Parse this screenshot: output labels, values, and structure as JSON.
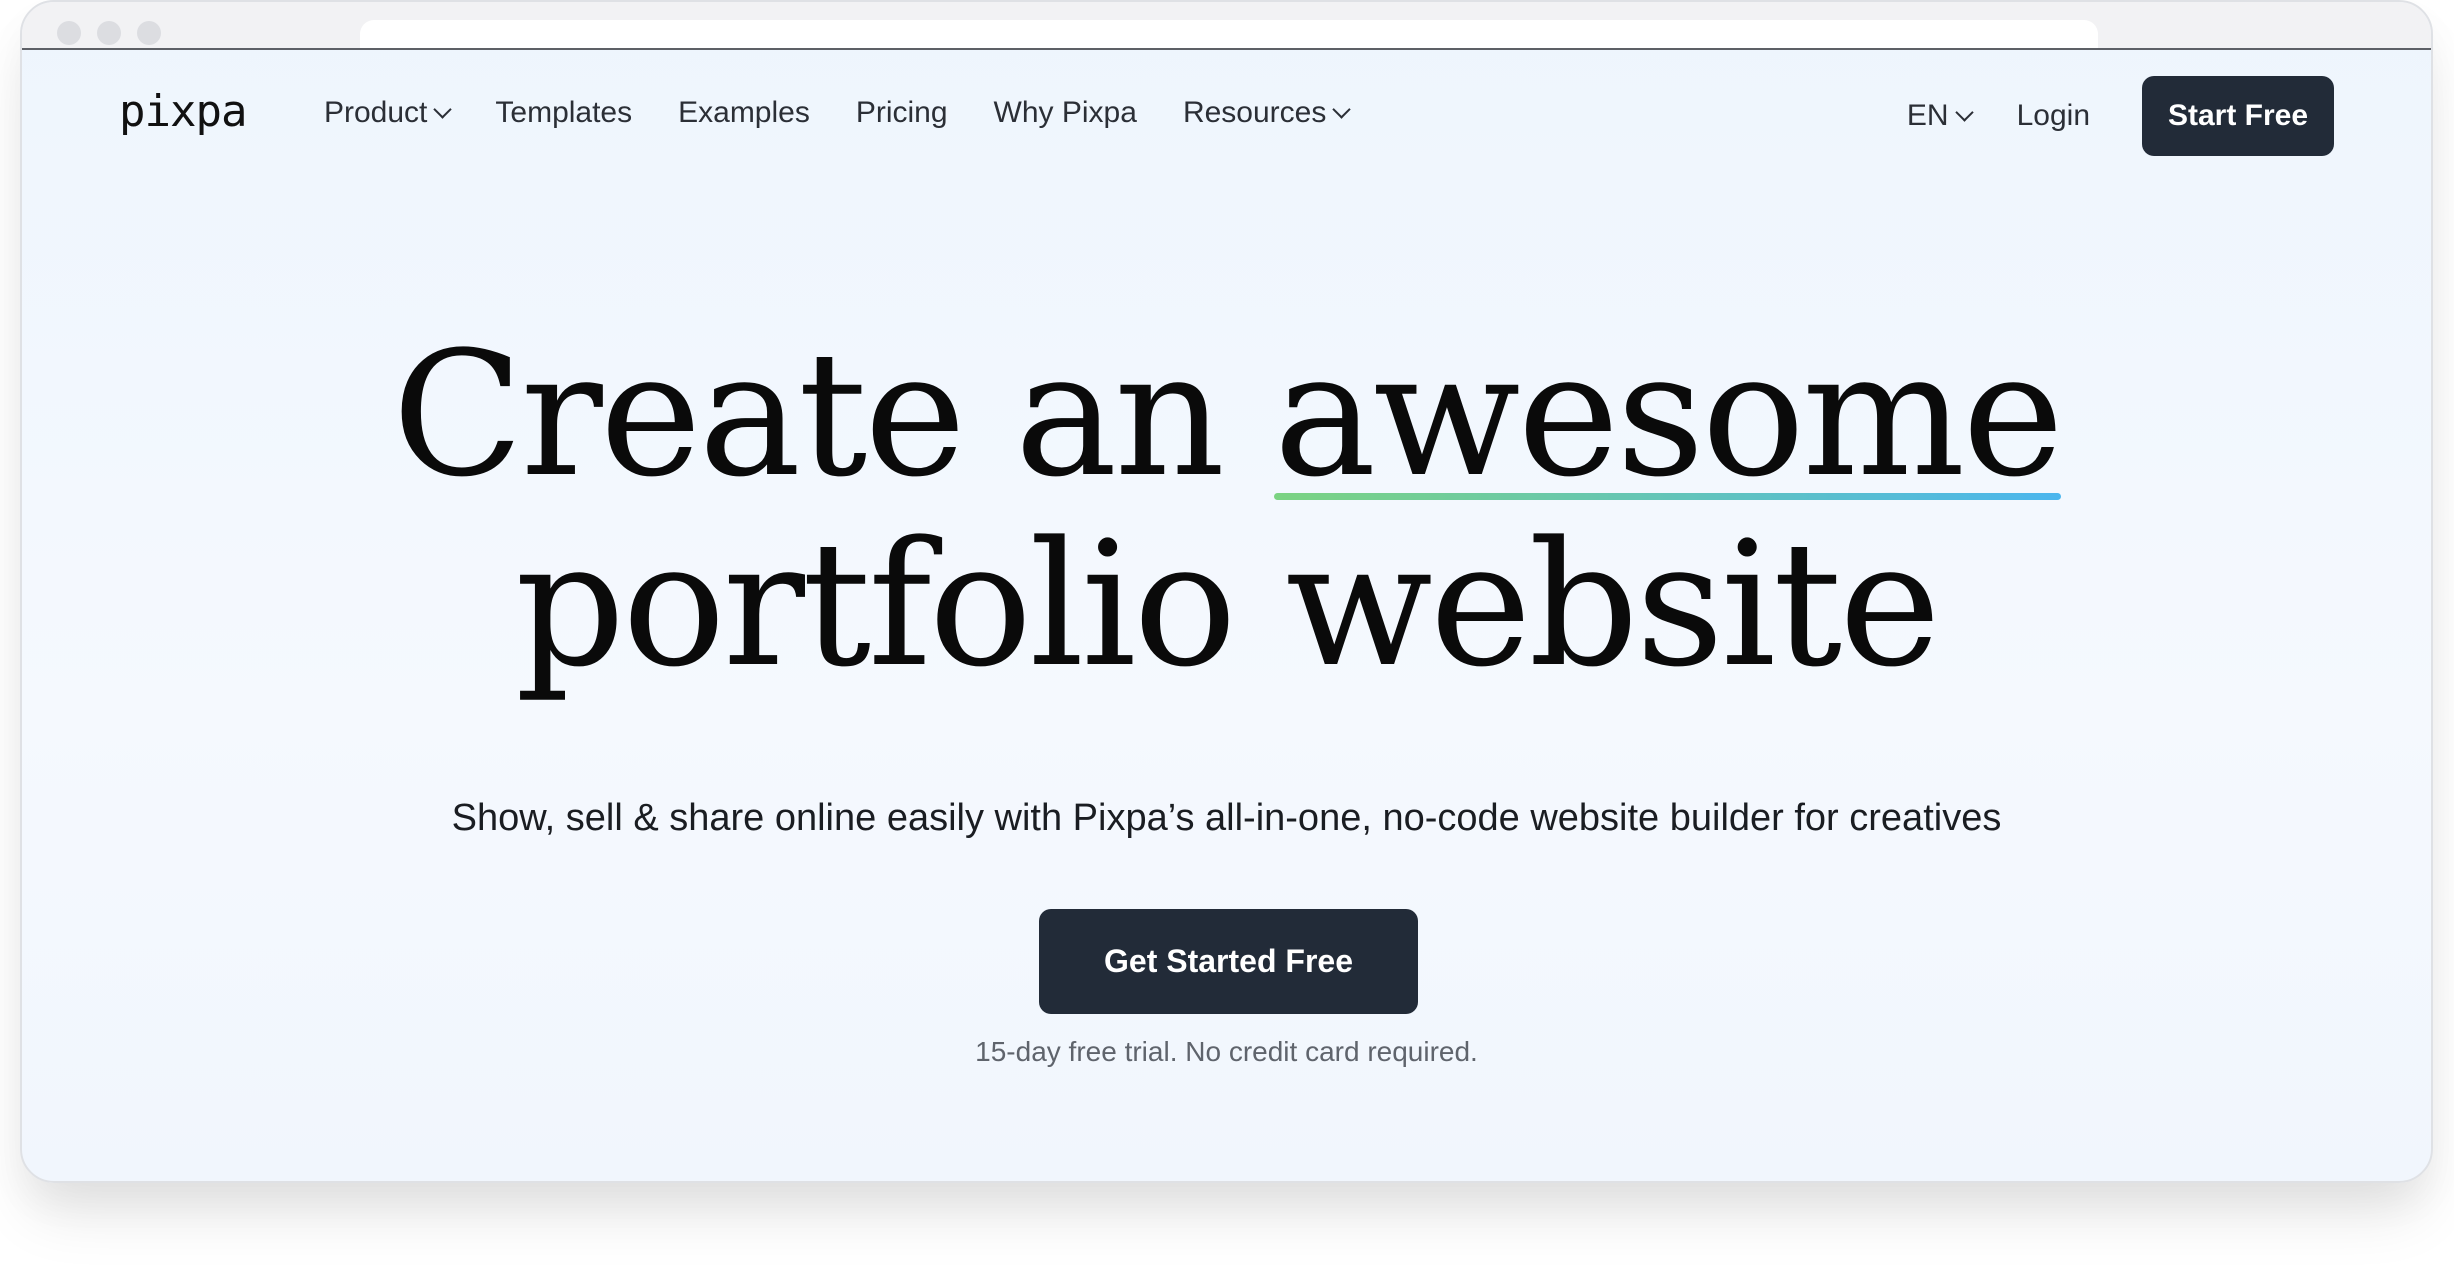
{
  "browser": {
    "window_controls": [
      "close",
      "minimize",
      "maximize"
    ],
    "address_bar": ""
  },
  "header": {
    "logo": "pixpa",
    "nav": [
      {
        "label": "Product",
        "has_dropdown": true
      },
      {
        "label": "Templates",
        "has_dropdown": false
      },
      {
        "label": "Examples",
        "has_dropdown": false
      },
      {
        "label": "Pricing",
        "has_dropdown": false
      },
      {
        "label": "Why Pixpa",
        "has_dropdown": false
      },
      {
        "label": "Resources",
        "has_dropdown": true
      }
    ],
    "language": "EN",
    "login": "Login",
    "start_free": "Start Free"
  },
  "hero": {
    "title_part1": "Create an ",
    "title_highlight": "awesome",
    "title_line2": "portfolio website",
    "subtitle": "Show, sell & share online easily with Pixpa’s all-in-one, no-code website builder for creatives",
    "cta": "Get Started Free",
    "note": "15-day free trial. No credit card required."
  },
  "colors": {
    "primary_button": "#222b38",
    "underline_start": "#7bd382",
    "underline_end": "#4bb6ee",
    "background": "#f1f7fe"
  }
}
